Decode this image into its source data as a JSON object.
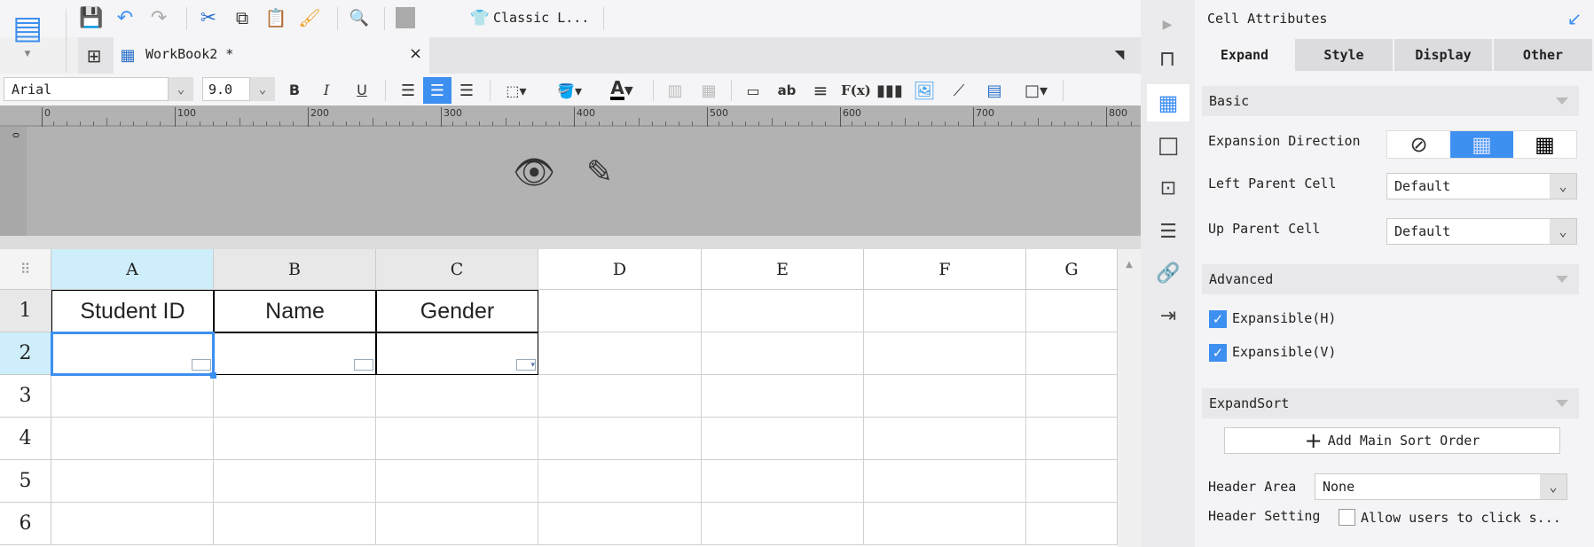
{
  "toolbar": {
    "style_label": "Classic L..."
  },
  "tab": {
    "title": "WorkBook2 *",
    "close": "×"
  },
  "format": {
    "font": "Arial",
    "size": "9.0",
    "bold": "B",
    "italic": "I",
    "underline": "U",
    "text_ab": "ab",
    "fx": "F(x)",
    "font_color": "A"
  },
  "ruler": {
    "ticks": [
      "0",
      "100",
      "200",
      "300",
      "400",
      "500",
      "600",
      "700",
      "800"
    ],
    "vticks": [
      "0"
    ]
  },
  "grid": {
    "columns": [
      "A",
      "B",
      "C",
      "D",
      "E",
      "F",
      "G"
    ],
    "rows": [
      "1",
      "2",
      "3",
      "4",
      "5",
      "6"
    ],
    "row1": [
      "Student ID",
      "Name",
      "Gender"
    ]
  },
  "panel": {
    "title": "Cell Attributes",
    "tabs": [
      "Expand",
      "Style",
      "Display",
      "Other"
    ],
    "basic": "Basic",
    "expansion_direction": "Expansion Direction",
    "left_parent": "Left Parent Cell",
    "left_parent_value": "Default",
    "up_parent": "Up Parent Cell",
    "up_parent_value": "Default",
    "advanced": "Advanced",
    "expansible_h": "Expansible(H)",
    "expansible_v": "Expansible(V)",
    "expand_sort": "ExpandSort",
    "add_sort": "Add Main Sort Order",
    "header_area": "Header Area",
    "header_area_value": "None",
    "header_setting": "Header Setting",
    "allow_click": "Allow users to click s..."
  },
  "colors": {
    "accent": "#3d8ff0",
    "selected_header": "#cdeefa"
  }
}
